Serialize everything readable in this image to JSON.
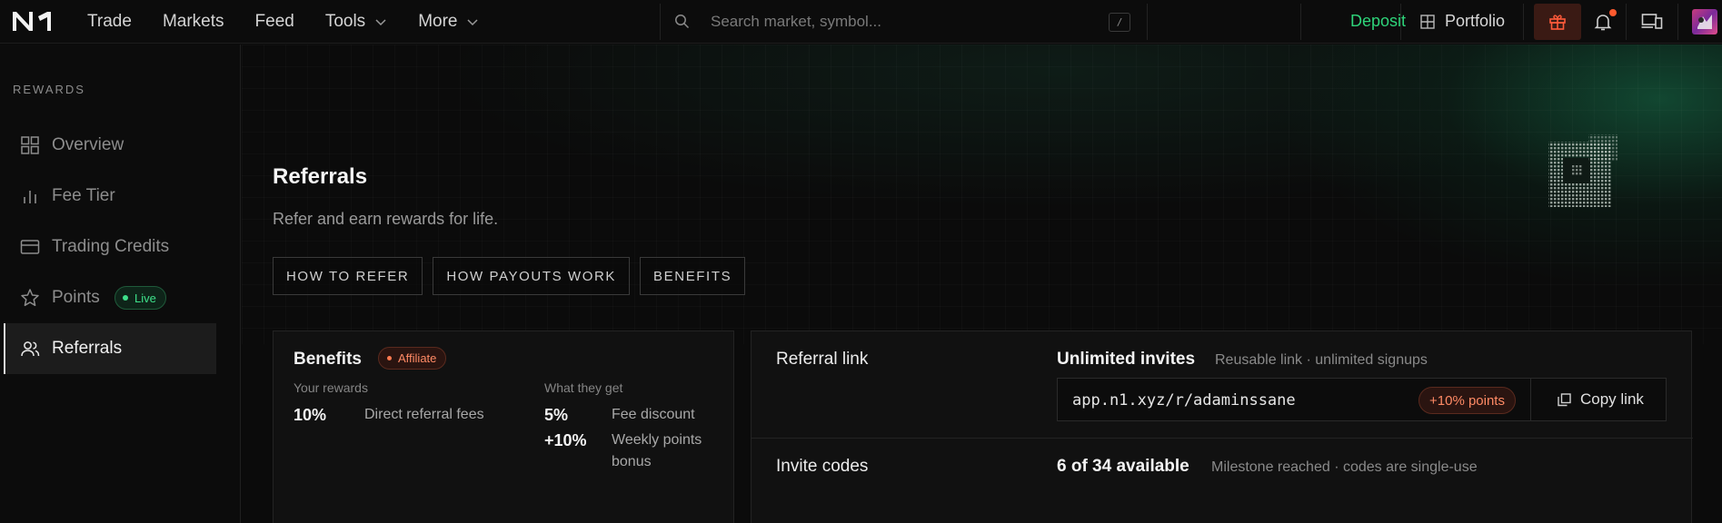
{
  "nav": {
    "items": [
      {
        "label": "Trade",
        "has_chevron": false
      },
      {
        "label": "Markets",
        "has_chevron": false
      },
      {
        "label": "Feed",
        "has_chevron": false
      },
      {
        "label": "Tools",
        "has_chevron": true
      },
      {
        "label": "More",
        "has_chevron": true
      }
    ],
    "search_placeholder": "Search market, symbol...",
    "search_shortcut": "/",
    "deposit": "Deposit",
    "portfolio": "Portfolio"
  },
  "colors": {
    "accent_green": "#2ed47a",
    "badge_orange": "#ff8a65",
    "gift_bg": "#3a1a14",
    "notification_dot": "#ff5a2e"
  },
  "sidebar": {
    "title": "REWARDS",
    "items": [
      {
        "label": "Overview",
        "icon": "grid-icon"
      },
      {
        "label": "Fee Tier",
        "icon": "bar-chart-icon"
      },
      {
        "label": "Trading Credits",
        "icon": "credit-card-icon"
      },
      {
        "label": "Points",
        "icon": "star-icon",
        "badge": "Live"
      },
      {
        "label": "Referrals",
        "icon": "users-icon",
        "active": true
      }
    ]
  },
  "page": {
    "title": "Referrals",
    "subtitle": "Refer and earn rewards for life.",
    "chips": [
      "HOW TO REFER",
      "HOW PAYOUTS WORK",
      "BENEFITS"
    ]
  },
  "benefits": {
    "title": "Benefits",
    "badge": "Affiliate",
    "your_rewards_head": "Your rewards",
    "they_get_head": "What they get",
    "your_rewards": [
      {
        "value": "10%",
        "label": "Direct referral fees"
      }
    ],
    "they_get": [
      {
        "value": "5%",
        "label": "Fee discount"
      },
      {
        "value": "+10%",
        "label": "Weekly points bonus"
      }
    ]
  },
  "referral": {
    "link_label": "Referral link",
    "link_head": "Unlimited invites",
    "link_note": "Reusable link · unlimited signups",
    "link_url": "app.n1.xyz/r/adaminssane",
    "link_badge": "+10% points",
    "copy_label": "Copy link",
    "codes_label": "Invite codes",
    "codes_head": "6 of 34 available",
    "codes_note": "Milestone reached · codes are single-use"
  }
}
